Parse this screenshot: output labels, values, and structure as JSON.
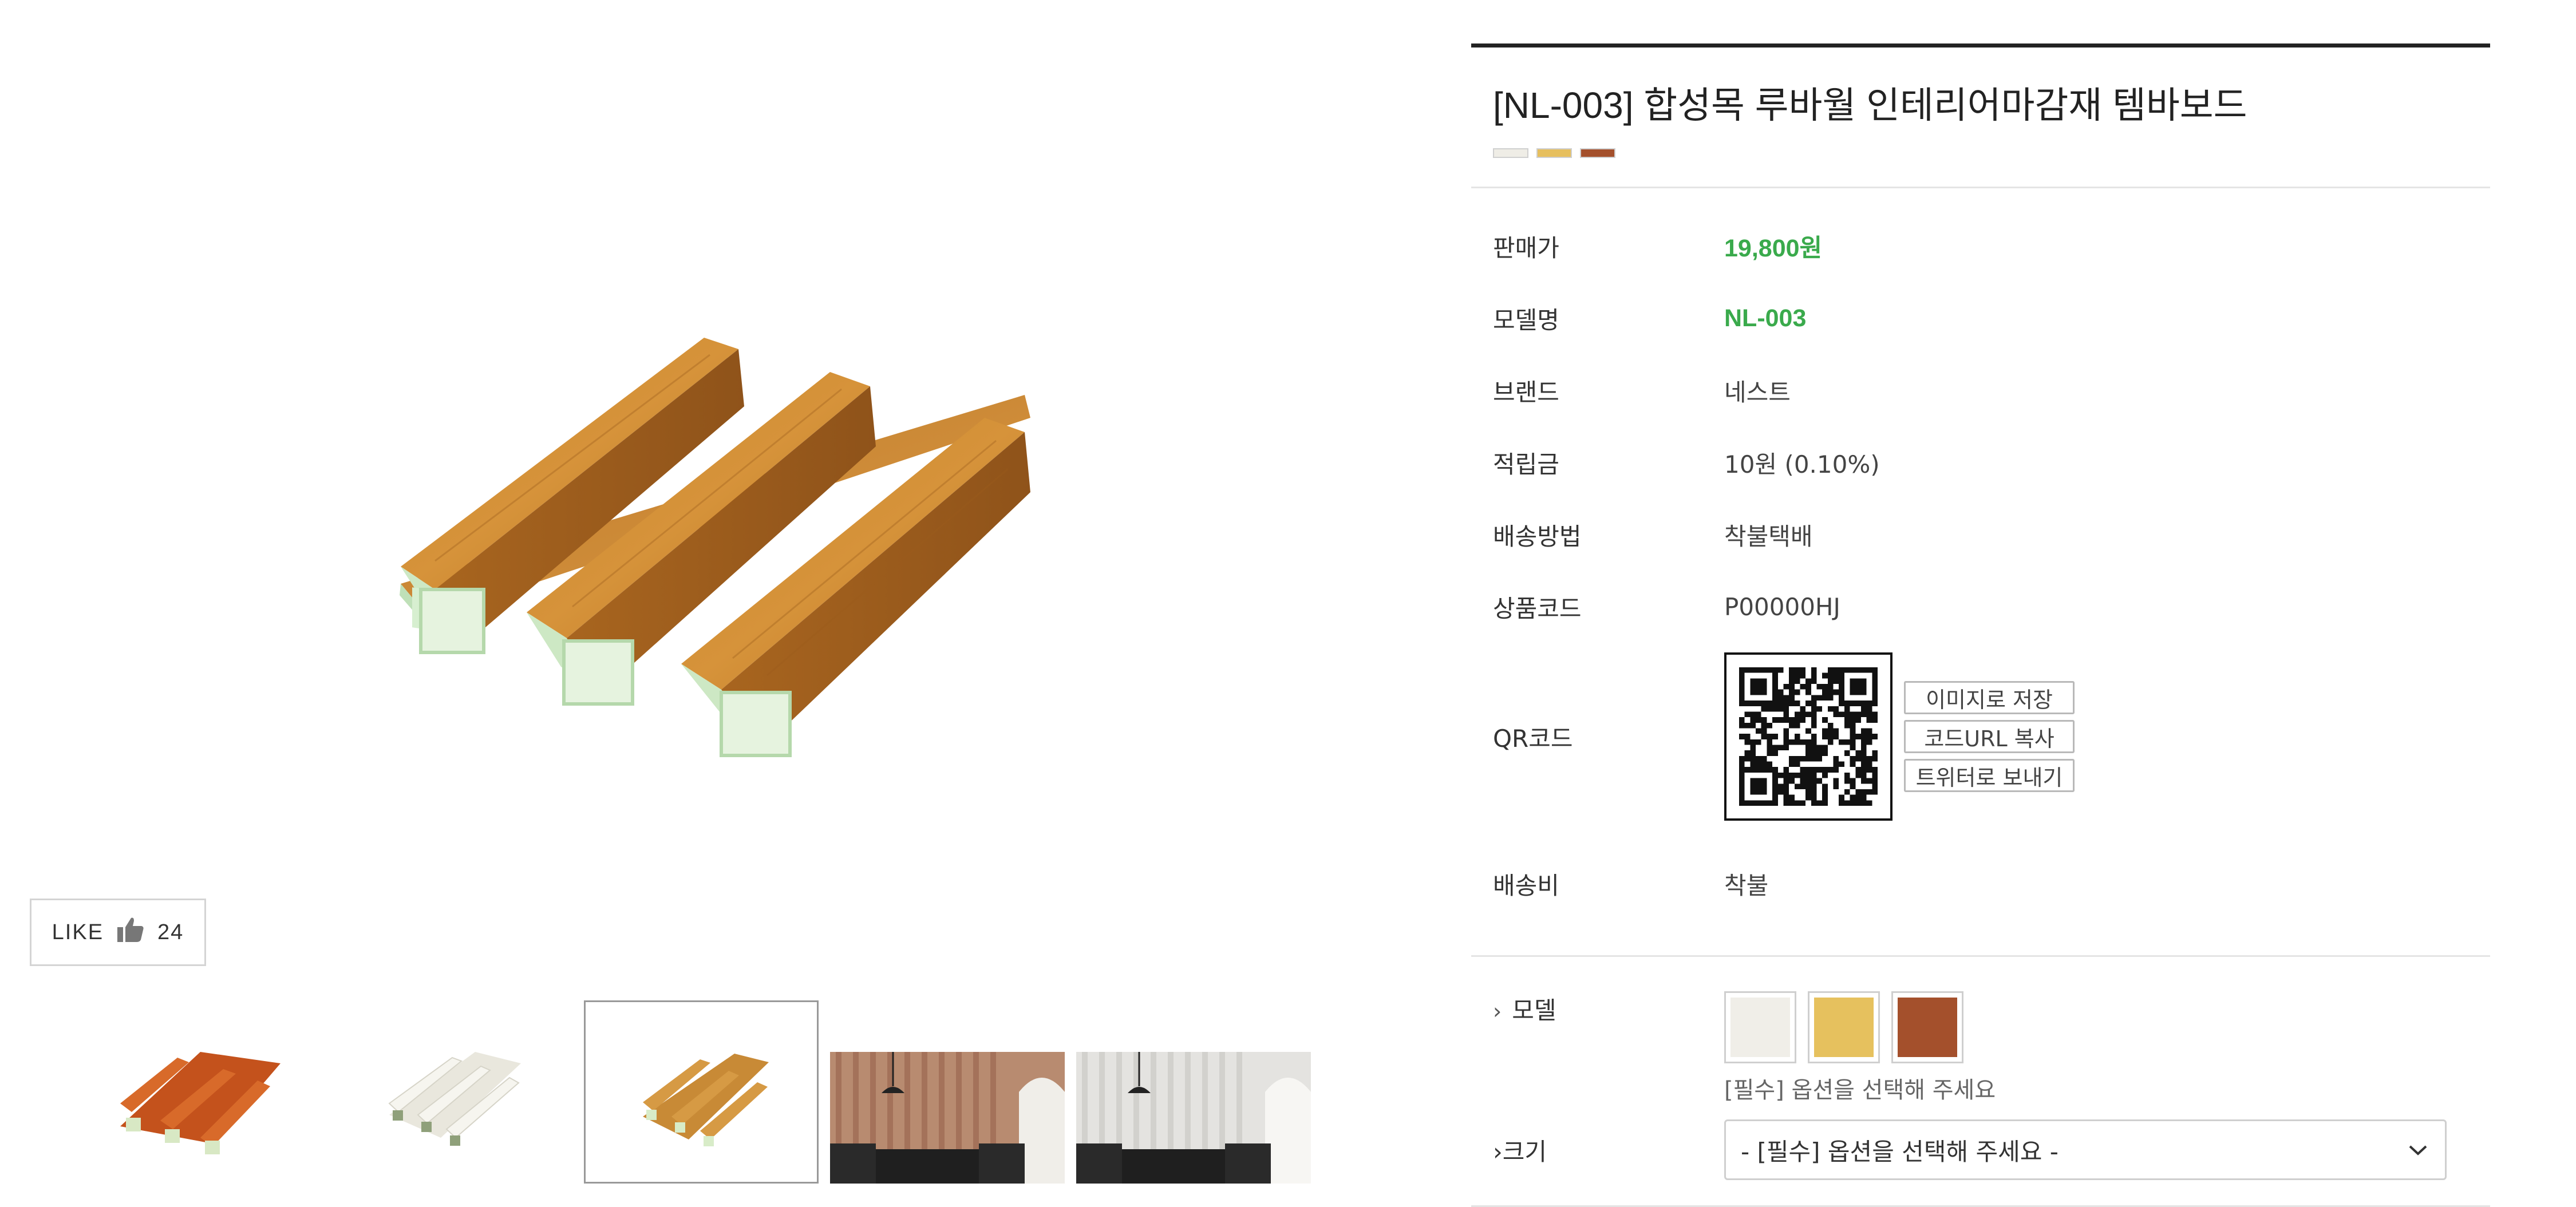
{
  "product": {
    "title": "[NL-003] 합성목 루바월 인테리어마감재 템바보드",
    "color_swatches": [
      "#efede6",
      "#e6bf5e",
      "#a4502c"
    ]
  },
  "like": {
    "label": "LIKE",
    "count": "24",
    "icon": "thumbs-up-icon"
  },
  "gallery": {
    "thumbnails": [
      {
        "name": "thumb-orange-panel"
      },
      {
        "name": "thumb-white-panel"
      },
      {
        "name": "thumb-oak-panel",
        "selected": true
      },
      {
        "name": "thumb-brown-interior"
      },
      {
        "name": "thumb-white-interior"
      }
    ]
  },
  "info": {
    "rows": [
      {
        "label": "판매가",
        "value": "19,800원",
        "highlight": true
      },
      {
        "label": "모델명",
        "value": "NL-003",
        "highlight": true
      },
      {
        "label": "브랜드",
        "value": "네스트"
      },
      {
        "label": "적립금",
        "value": "10원 (0.10%)"
      },
      {
        "label": "배송방법",
        "value": "착불택배"
      },
      {
        "label": "상품코드",
        "value": "P00000HJ"
      }
    ],
    "qr": {
      "label": "QR코드",
      "buttons": [
        "이미지로 저장",
        "코드URL 복사",
        "트위터로 보내기"
      ]
    },
    "shipping_fee": {
      "label": "배송비",
      "value": "착불"
    }
  },
  "options": {
    "model": {
      "label": "모델",
      "choices": [
        "#f0eee8",
        "#e6c15e",
        "#a4502c"
      ],
      "hint": "[필수] 옵션을 선택해 주세요"
    },
    "size": {
      "label": "크기",
      "placeholder": "- [필수] 옵션을 선택해 주세요 -"
    }
  },
  "colors": {
    "price_green": "#3aaa4c",
    "rule": "#e4e4e4"
  }
}
